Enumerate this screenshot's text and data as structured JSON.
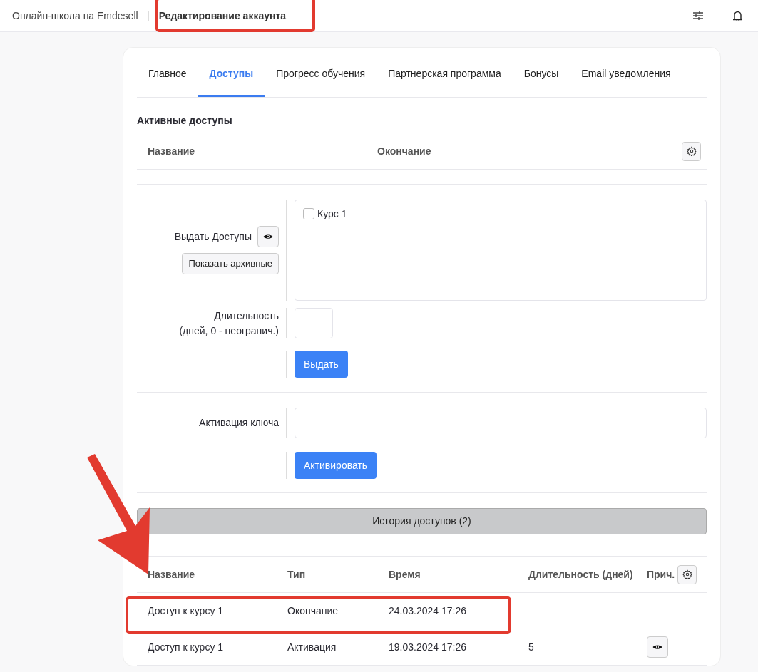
{
  "header": {
    "breadcrumbs": [
      {
        "label": "Онлайн-школа на Emdesell",
        "selected": false
      },
      {
        "label": "Редактирование аккаунта",
        "selected": true
      }
    ]
  },
  "tabs": [
    {
      "label": "Главное",
      "selected": false
    },
    {
      "label": "Доступы",
      "selected": true
    },
    {
      "label": "Прогресс обучения",
      "selected": false
    },
    {
      "label": "Партнерская программа",
      "selected": false
    },
    {
      "label": "Бонусы",
      "selected": false
    },
    {
      "label": "Email уведомления",
      "selected": false
    }
  ],
  "active_access": {
    "title": "Активные доступы",
    "columns": [
      "Название",
      "Окончание"
    ]
  },
  "grant": {
    "label": "Выдать Доступы",
    "archive_button": "Показать архивные",
    "courses": [
      {
        "label": "Курс 1",
        "checked": false
      }
    ],
    "duration_label": [
      "Длительность",
      "(дней, 0 - неогранич.)"
    ],
    "submit": "Выдать"
  },
  "key": {
    "label": "Активация ключа",
    "submit": "Активировать"
  },
  "history": {
    "toggle": "История доступов (2)",
    "columns": [
      "Название",
      "Тип",
      "Время",
      "Длительность (дней)",
      "Прич."
    ],
    "rows": [
      {
        "cells": [
          "Доступ к курсу 1",
          "Окончание",
          "24.03.2024 17:26",
          ""
        ],
        "details": false
      },
      {
        "cells": [
          "Доступ к курсу 1",
          "Активация",
          "19.03.2024 17:26",
          "5"
        ],
        "details": true
      }
    ]
  }
}
